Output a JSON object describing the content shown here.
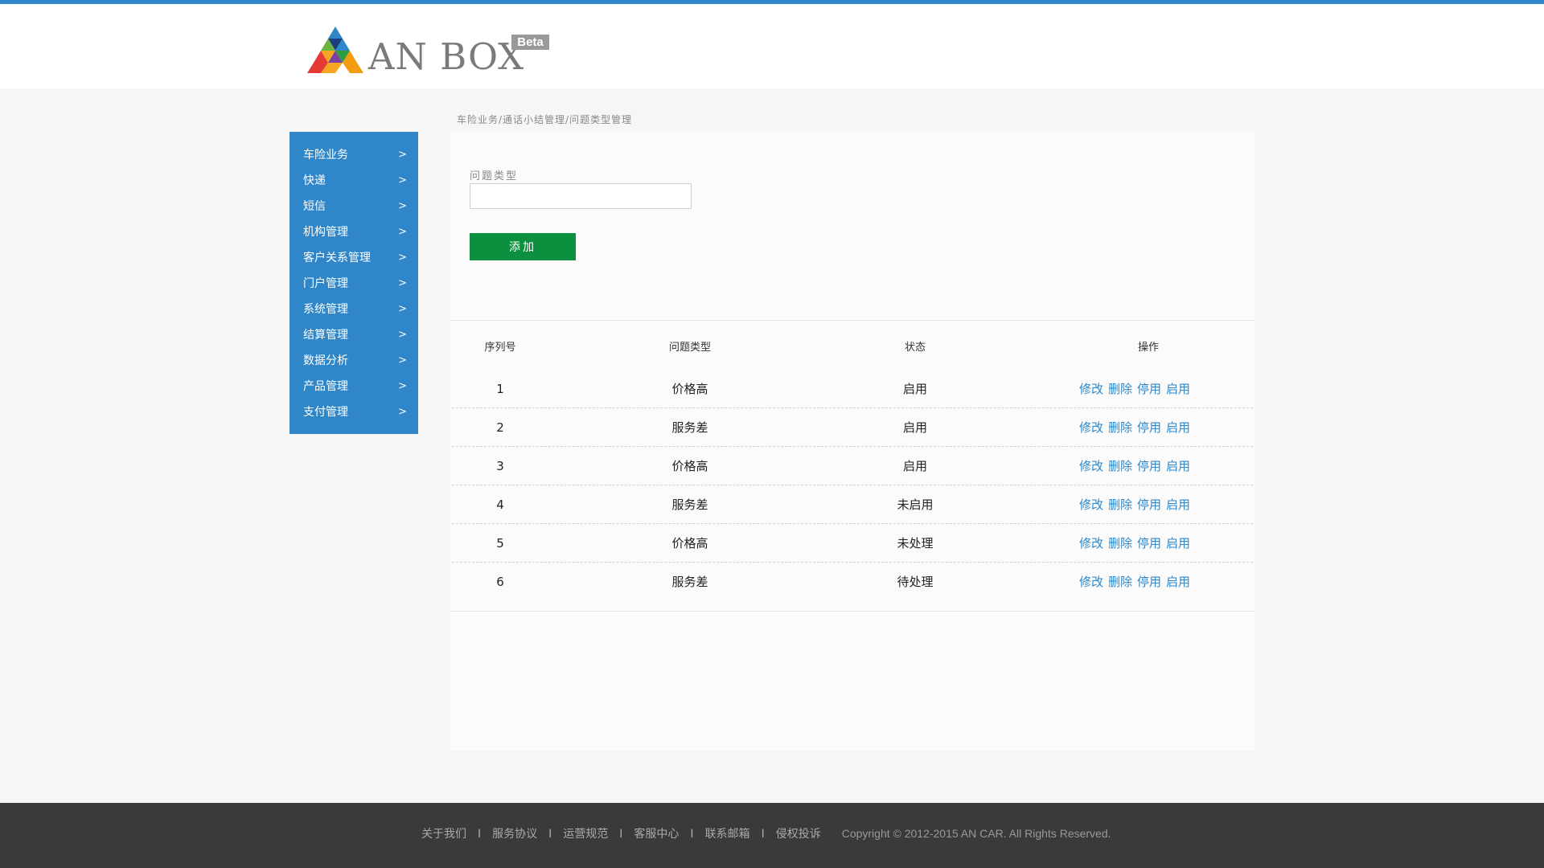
{
  "header": {
    "logo_text": "AN BOX",
    "beta_label": "Beta",
    "brand_colors": {
      "top_bar": "#2f87c9",
      "primary": "#2f87c9",
      "button": "#0c8f3e"
    }
  },
  "sidebar": {
    "items": [
      {
        "label": "车险业务",
        "arrow": ">"
      },
      {
        "label": "快递",
        "arrow": ">"
      },
      {
        "label": "短信",
        "arrow": ">"
      },
      {
        "label": "机构管理",
        "arrow": ">"
      },
      {
        "label": "客户关系管理",
        "arrow": ">"
      },
      {
        "label": "门户管理",
        "arrow": ">"
      },
      {
        "label": "系统管理",
        "arrow": ">"
      },
      {
        "label": "结算管理",
        "arrow": ">"
      },
      {
        "label": "数据分析",
        "arrow": ">"
      },
      {
        "label": "产品管理",
        "arrow": ">"
      },
      {
        "label": "支付管理",
        "arrow": ">"
      }
    ]
  },
  "breadcrumb": "车险业务/通话小结管理/问题类型管理",
  "form": {
    "label": "问题类型",
    "value": "",
    "add_button": "添加"
  },
  "table": {
    "headers": {
      "seq": "序列号",
      "type": "问题类型",
      "status": "状态",
      "ops": "操作"
    },
    "action_labels": {
      "edit": "修改",
      "delete": "删除",
      "disable": "停用",
      "enable": "启用"
    },
    "rows": [
      {
        "seq": "1",
        "type": "价格高",
        "status": "启用"
      },
      {
        "seq": "2",
        "type": "服务差",
        "status": "启用"
      },
      {
        "seq": "3",
        "type": "价格高",
        "status": "启用"
      },
      {
        "seq": "4",
        "type": "服务差",
        "status": "未启用"
      },
      {
        "seq": "5",
        "type": "价格高",
        "status": "未处理"
      },
      {
        "seq": "6",
        "type": "服务差",
        "status": "待处理"
      }
    ]
  },
  "footer": {
    "links": [
      "关于我们",
      "服务协议",
      "运营规范",
      "客服中心",
      "联系邮箱",
      "侵权投诉"
    ],
    "separator": "I",
    "copyright": "Copyright © 2012-2015 AN CAR.  All Rights Reserved."
  }
}
